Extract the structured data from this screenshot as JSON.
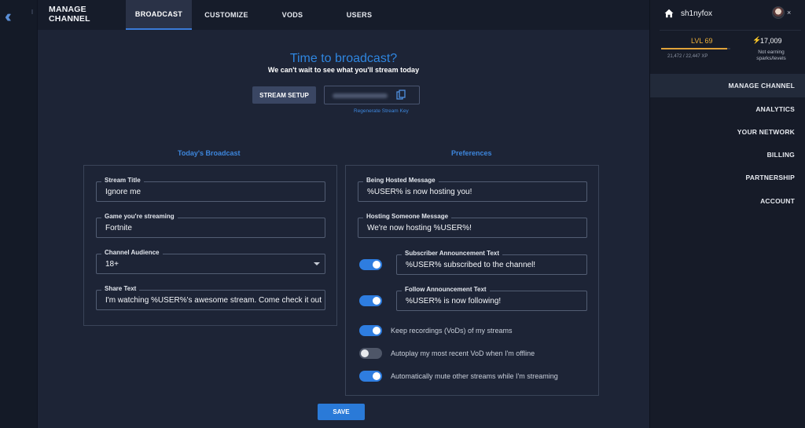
{
  "header": {
    "title_line1": "MANAGE",
    "title_line2": "CHANNEL",
    "tabs": [
      {
        "label": "BROADCAST"
      },
      {
        "label": "CUSTOMIZE"
      },
      {
        "label": "VODS"
      },
      {
        "label": "USERS"
      }
    ]
  },
  "hero": {
    "title": "Time to broadcast?",
    "subtitle": "We can't wait to see what you'll stream today"
  },
  "stream": {
    "setup_label": "STREAM SETUP",
    "regenerate_label": "Regenerate Stream Key"
  },
  "broadcast": {
    "section_title": "Today's Broadcast",
    "fields": [
      {
        "label": "Stream Title",
        "value": "Ignore me"
      },
      {
        "label": "Game you're streaming",
        "value": "Fortnite"
      },
      {
        "label": "Channel Audience",
        "value": "18+"
      },
      {
        "label": "Share Text",
        "value": "I'm watching %USER%'s awesome stream. Come check it out"
      }
    ]
  },
  "preferences": {
    "section_title": "Preferences",
    "hosted": {
      "label": "Being Hosted Message",
      "value": "%USER% is now hosting you!"
    },
    "hosting": {
      "label": "Hosting Someone Message",
      "value": "We're now hosting %USER%!"
    },
    "subscriber": {
      "label": "Subscriber Announcement Text",
      "value": "%USER% subscribed to the channel!",
      "enabled": true
    },
    "follow": {
      "label": "Follow Announcement Text",
      "value": "%USER% is now following!",
      "enabled": true
    },
    "toggles": [
      {
        "label": "Keep recordings (VoDs) of my streams",
        "enabled": true
      },
      {
        "label": "Autoplay my most recent VoD when I'm offline",
        "enabled": false
      },
      {
        "label": "Automatically mute other streams while I'm streaming",
        "enabled": true
      }
    ]
  },
  "save_label": "SAVE",
  "user": {
    "name": "sh1nyfox",
    "close": "×",
    "level": "LVL 69",
    "level_progress": 0.95,
    "xp": "21,472 / 22,447 XP",
    "sparks": "17,009",
    "spark_note": "Not earning sparks/levels"
  },
  "sidebar": {
    "items": [
      {
        "label": "MANAGE CHANNEL"
      },
      {
        "label": "ANALYTICS"
      },
      {
        "label": "YOUR NETWORK"
      },
      {
        "label": "BILLING"
      },
      {
        "label": "PARTNERSHIP"
      },
      {
        "label": "ACCOUNT"
      }
    ]
  },
  "colors": {
    "accent": "#2f86e0",
    "toggle_on": "#2e7de0",
    "level": "#f0b23a"
  }
}
